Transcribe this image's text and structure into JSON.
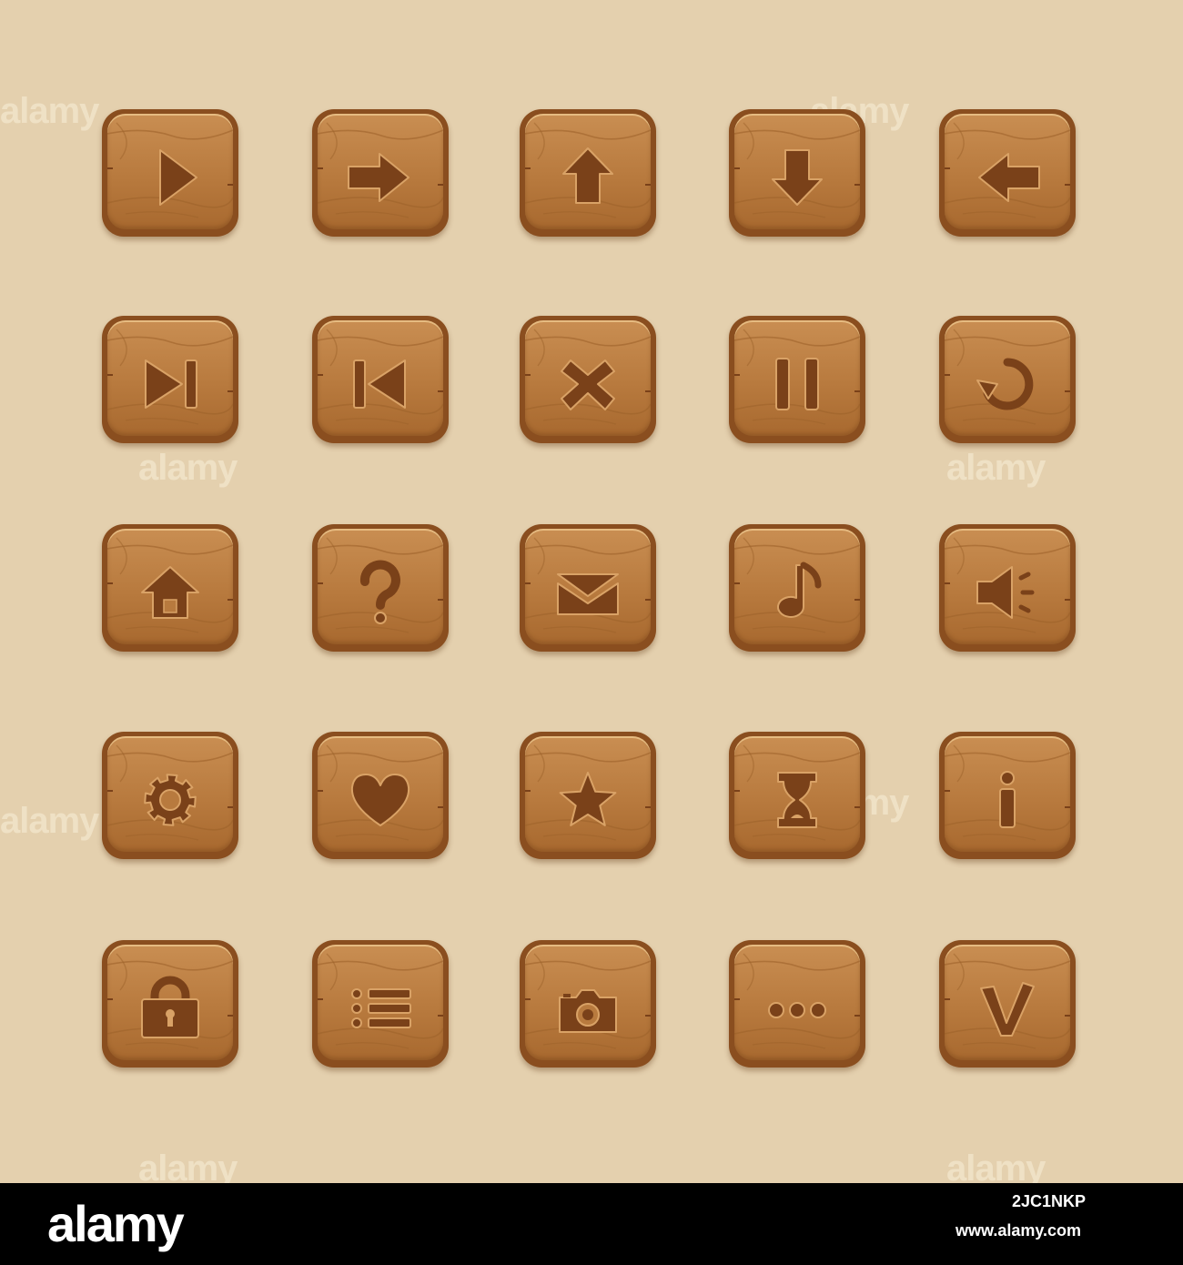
{
  "colors": {
    "background": "#e4d0ae",
    "button_rim": "#8a4e1f",
    "button_face": "#b87a3e",
    "icon_fill": "#7a4119",
    "icon_highlight": "#d9a266",
    "footer": "#000000"
  },
  "buttons": [
    {
      "icon": "play"
    },
    {
      "icon": "arrow-right"
    },
    {
      "icon": "arrow-up"
    },
    {
      "icon": "arrow-down"
    },
    {
      "icon": "arrow-left"
    },
    {
      "icon": "skip-forward"
    },
    {
      "icon": "skip-back"
    },
    {
      "icon": "close"
    },
    {
      "icon": "pause"
    },
    {
      "icon": "restart"
    },
    {
      "icon": "home"
    },
    {
      "icon": "question"
    },
    {
      "icon": "mail"
    },
    {
      "icon": "music"
    },
    {
      "icon": "sound"
    },
    {
      "icon": "gear"
    },
    {
      "icon": "heart"
    },
    {
      "icon": "star"
    },
    {
      "icon": "hourglass"
    },
    {
      "icon": "info"
    },
    {
      "icon": "lock"
    },
    {
      "icon": "list"
    },
    {
      "icon": "camera"
    },
    {
      "icon": "more"
    },
    {
      "icon": "check"
    }
  ],
  "watermark": "alamy",
  "footer": {
    "logo": "alamy",
    "image_id": "2JC1NKP",
    "site": "www.alamy.com"
  }
}
